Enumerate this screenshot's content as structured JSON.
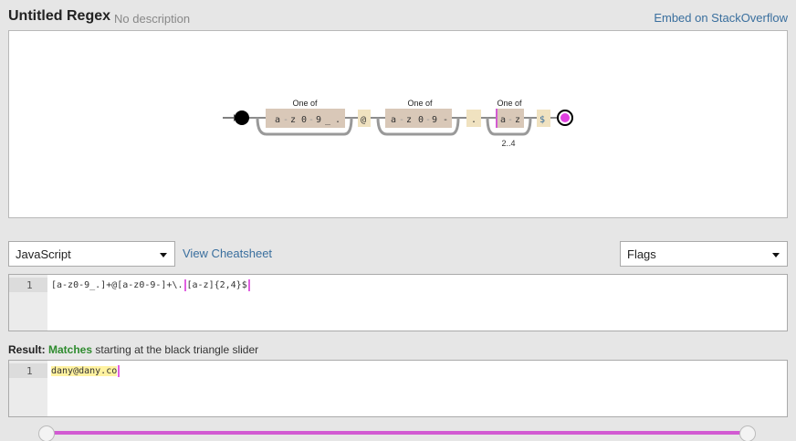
{
  "header": {
    "title": "Untitled Regex",
    "description": "No description",
    "embed_link": "Embed on StackOverflow"
  },
  "diagram": {
    "groups": [
      {
        "label": "One of",
        "chars": [
          "a",
          "z",
          "0",
          "9",
          "_",
          "."
        ]
      },
      {
        "label": "One of",
        "chars": [
          "a",
          "z",
          "0",
          "9",
          "-"
        ]
      },
      {
        "label": "One of",
        "chars": [
          "a",
          "z"
        ],
        "repeat": "2..4"
      }
    ],
    "literals": [
      "@",
      ".",
      "$"
    ]
  },
  "controls": {
    "language": "JavaScript",
    "cheatsheet": "View Cheatsheet",
    "flags": "Flags"
  },
  "regex_editor": {
    "line": "1",
    "parts": [
      "[a-z0-9_.]+@[a-z0-9-]+\\.",
      "[a-z]{2,4}$"
    ]
  },
  "result": {
    "label": "Result:",
    "status": "Matches",
    "text": "starting at the black triangle slider"
  },
  "test_editor": {
    "line": "1",
    "text": "dany@dany.co"
  },
  "colors": {
    "accent": "#d25bd2",
    "link": "#3a6f9e",
    "match_green": "#2e8b2e",
    "char_class_bg": "#d9c8b8",
    "literal_bg": "#f0e2c0"
  }
}
